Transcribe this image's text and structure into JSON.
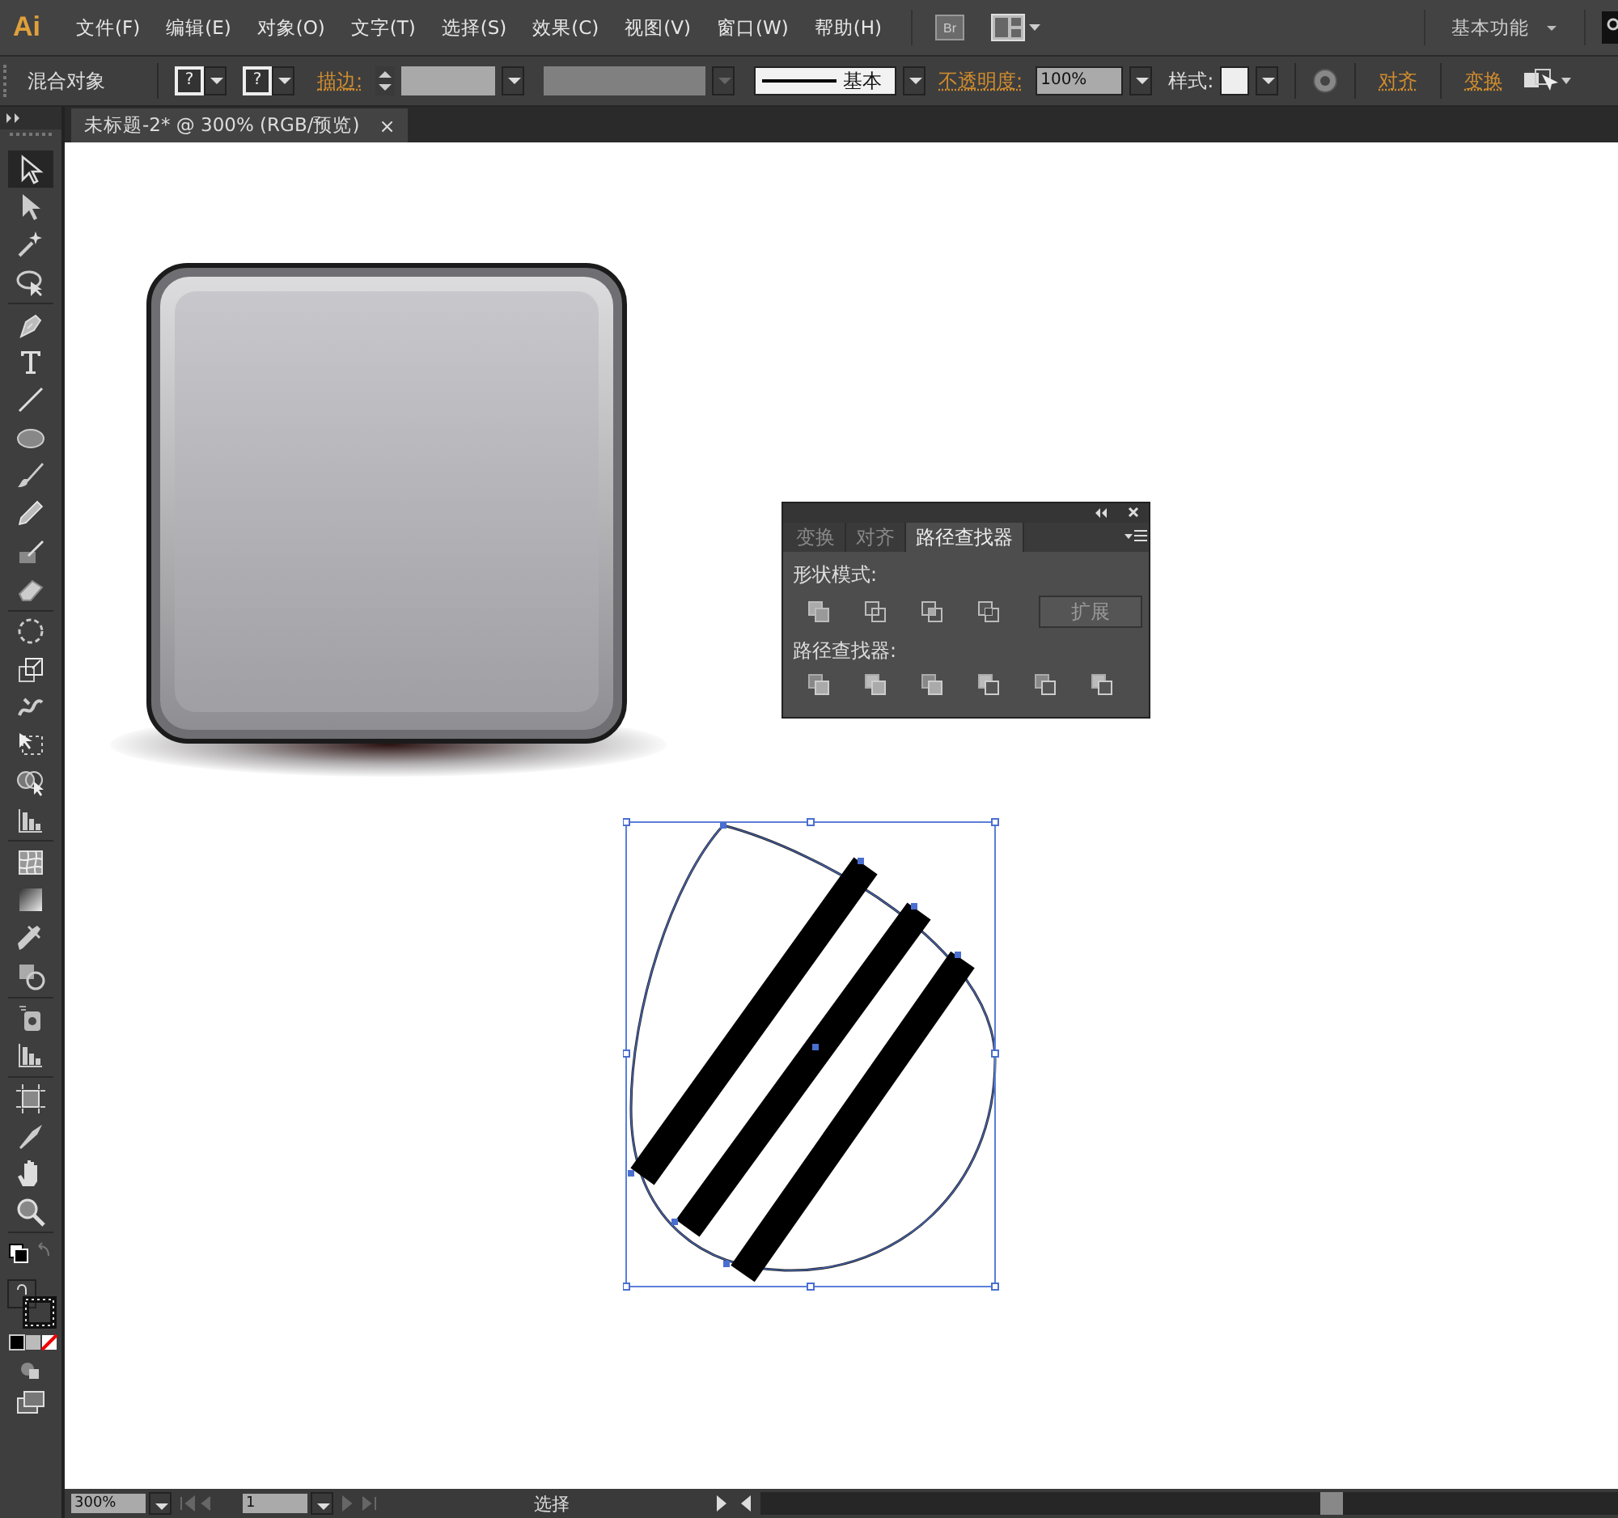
{
  "app": {
    "logo": "Ai",
    "menus": [
      "文件(F)",
      "编辑(E)",
      "对象(O)",
      "文字(T)",
      "选择(S)",
      "效果(C)",
      "视图(V)",
      "窗口(W)",
      "帮助(H)"
    ],
    "bridge": "Br",
    "workspace": "基本功能"
  },
  "control_bar": {
    "object_label": "混合对象",
    "fill": "?",
    "stroke": "?",
    "stroke_link": "描边:",
    "stroke_profile": "基本",
    "opacity_link": "不透明度:",
    "opacity": "100%",
    "style_label": "样式:",
    "align_link": "对齐",
    "transform_link": "变换"
  },
  "document_tab": {
    "title": "未标题-2* @ 300% (RGB/预览)",
    "close": "×"
  },
  "tool_groups": [
    [
      {
        "kind": "selection",
        "selected": true
      },
      {
        "kind": "direct",
        "selected": false
      },
      {
        "kind": "wand",
        "selected": false
      },
      {
        "kind": "lasso",
        "selected": false
      }
    ],
    [
      {
        "kind": "pen",
        "selected": false
      },
      {
        "kind": "type",
        "selected": false
      },
      {
        "kind": "line",
        "selected": false
      },
      {
        "kind": "ellipse",
        "selected": false
      },
      {
        "kind": "brush",
        "selected": false
      },
      {
        "kind": "pencil",
        "selected": false
      },
      {
        "kind": "blob",
        "selected": false
      },
      {
        "kind": "eraser",
        "selected": false
      }
    ],
    [
      {
        "kind": "rotate",
        "selected": false
      },
      {
        "kind": "scale",
        "selected": false
      },
      {
        "kind": "warp",
        "selected": false
      },
      {
        "kind": "freetransform",
        "selected": false
      },
      {
        "kind": "shapebuilder",
        "selected": false
      },
      {
        "kind": "graph",
        "selected": false
      }
    ],
    [
      {
        "kind": "mesh",
        "selected": false
      },
      {
        "kind": "gradient",
        "selected": false
      },
      {
        "kind": "eyedropper",
        "selected": false
      },
      {
        "kind": "blend",
        "selected": false
      }
    ],
    [
      {
        "kind": "symbol",
        "selected": false
      },
      {
        "kind": "graph",
        "selected": false
      }
    ],
    [
      {
        "kind": "artboard",
        "selected": false
      },
      {
        "kind": "slice",
        "selected": false
      },
      {
        "kind": "hand",
        "selected": false
      },
      {
        "kind": "zoom",
        "selected": false
      }
    ]
  ],
  "pathfinder_panel": {
    "tabs": [
      {
        "label": "变换",
        "selected": false
      },
      {
        "label": "对齐",
        "selected": false
      },
      {
        "label": "路径查找器",
        "selected": true
      }
    ],
    "shape_modes_label": "形状模式:",
    "expand_button": {
      "label": "扩展",
      "disabled": true
    },
    "pathfinders_label": "路径查找器:"
  },
  "status_bar": {
    "zoom": "300%",
    "page": "1",
    "status": "选择"
  }
}
